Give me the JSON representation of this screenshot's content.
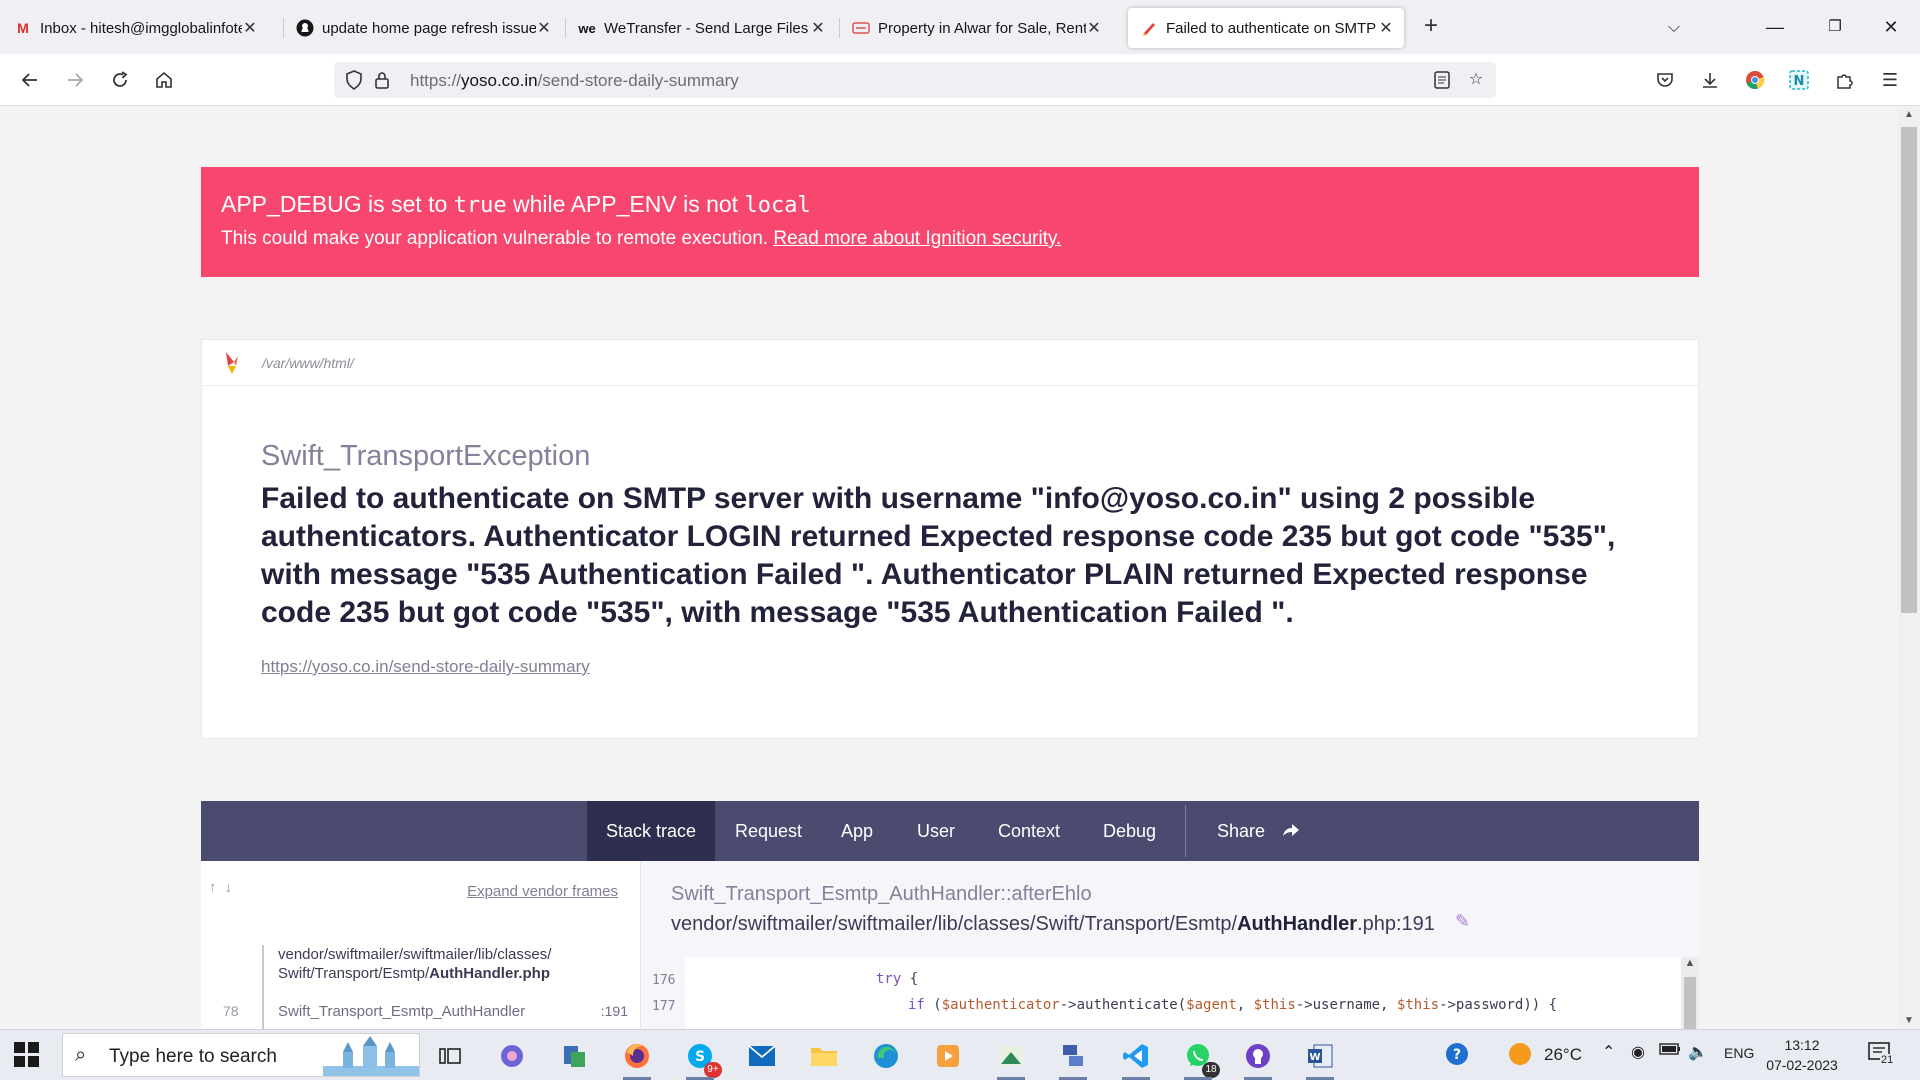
{
  "browser": {
    "tabs": [
      {
        "label": "Inbox - hitesh@imgglobalinfotech.com",
        "favicon": "gmail-icon"
      },
      {
        "label": "update home page refresh issue",
        "favicon": "github-icon"
      },
      {
        "label": "WeTransfer - Send Large Files & Share",
        "favicon": "wetransfer-icon"
      },
      {
        "label": "Property in Alwar for Sale, Rent",
        "favicon": "property-site-icon"
      },
      {
        "label": "Failed to authenticate on SMTP server",
        "favicon": "ignition-icon"
      }
    ],
    "url_prefix": "https://",
    "url_host": "yoso.co.in",
    "url_path": "/send-store-daily-summary"
  },
  "banner": {
    "debug_key": "APP_DEBUG",
    "is_set_to": " is set to ",
    "true_word": "true",
    "while": " while ",
    "env_key": "APP_ENV",
    "is_not": " is not ",
    "local_word": "local",
    "message": "This could make your application vulnerable to remote execution. ",
    "link": "Read more about Ignition security."
  },
  "error": {
    "path": "/var/www/html/",
    "exception_class": "Swift_TransportException",
    "message": "Failed to authenticate on SMTP server with username \"info@yoso.co.in\" using 2 possible authenticators. Authenticator LOGIN returned Expected response code 235 but got code \"535\", with message \"535 Authentication Failed \". Authenticator PLAIN returned Expected response code 235 but got code \"535\", with message \"535 Authentication Failed \".",
    "url": "https://yoso.co.in/send-store-daily-summary"
  },
  "tabs": {
    "stack_trace": "Stack trace",
    "request": "Request",
    "app": "App",
    "user": "User",
    "context": "Context",
    "debug": "Debug",
    "share": "Share"
  },
  "trace": {
    "expand": "Expand vendor frames",
    "frame_path_line1": "vendor/swiftmailer/swiftmailer/lib/classes/",
    "frame_path_line2": "Swift/Transport/Esmtp/",
    "frame_path_file": "AuthHandler.php",
    "frame_number": "78",
    "frame_class": "Swift_Transport_Esmtp_AuthHandler",
    "frame_line": ":191",
    "selected_class": "Swift_Transport_Esmtp_AuthHandler",
    "selected_method": "::afterEhlo",
    "selected_dir": "vendor/swiftmailer/swiftmailer/lib/classes/Swift/Transport/Esmtp/",
    "selected_file": "AuthHandler",
    "selected_ext_line": ".php:191",
    "code": [
      {
        "line": "176",
        "text": "try {"
      },
      {
        "line": "177",
        "text": "if ($authenticator->authenticate($agent, $this->username, $this->password)) {"
      }
    ]
  },
  "taskbar": {
    "search_placeholder": "Type here to search",
    "weather": "26°C",
    "lang": "ENG",
    "time": "13:12",
    "date": "07-02-2023",
    "notifications": "21",
    "skype_badge": "9+",
    "whatsapp_badge": "18"
  }
}
